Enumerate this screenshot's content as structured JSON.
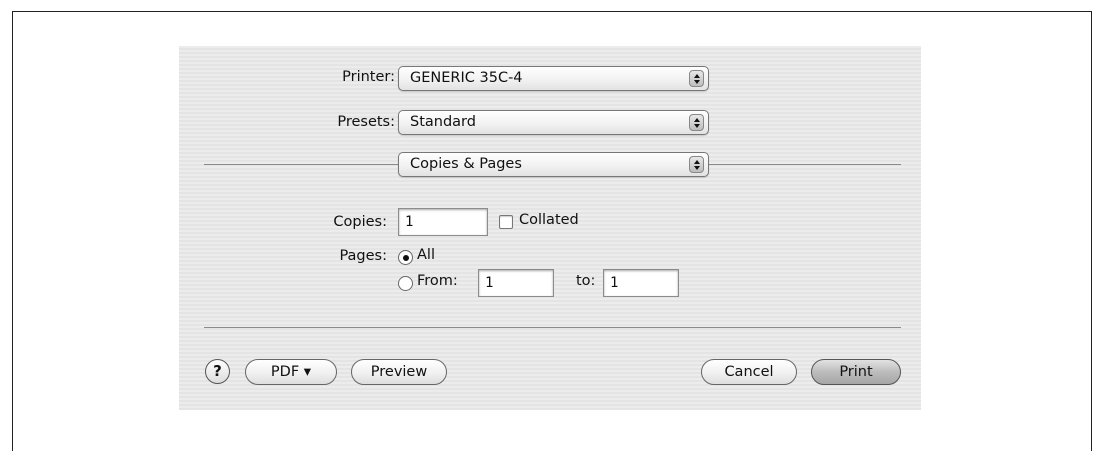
{
  "printer": {
    "label": "Printer:",
    "value": "GENERIC 35C-4"
  },
  "presets": {
    "label": "Presets:",
    "value": "Standard"
  },
  "panel": {
    "value": "Copies & Pages"
  },
  "copies": {
    "label": "Copies:",
    "value": "1",
    "collated_label": "Collated",
    "collated_checked": false
  },
  "pages": {
    "label": "Pages:",
    "all_label": "All",
    "all_selected": true,
    "from_label": "From:",
    "from_value": "1",
    "to_label": "to:",
    "to_value": "1"
  },
  "footer": {
    "help_label": "?",
    "pdf_label": "PDF ▾",
    "preview_label": "Preview",
    "cancel_label": "Cancel",
    "print_label": "Print"
  }
}
